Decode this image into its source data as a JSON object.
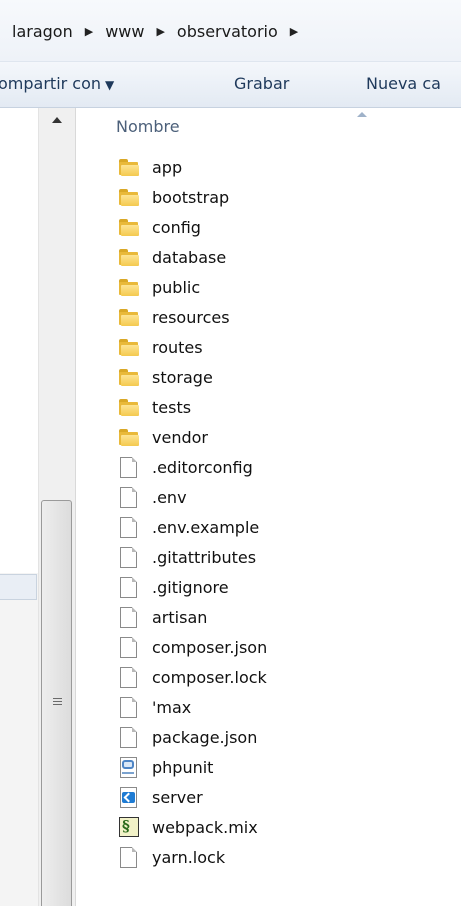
{
  "breadcrumb": {
    "items": [
      "laragon",
      "www",
      "observatorio"
    ],
    "separator": "▶"
  },
  "toolbar": {
    "share_label": "ompartir con",
    "record_label": "Grabar",
    "new_folder_label": "Nueva ca"
  },
  "column_header": {
    "name_label": "Nombre"
  },
  "files": [
    {
      "name": "app",
      "icon": "folder-icon"
    },
    {
      "name": "bootstrap",
      "icon": "folder-icon"
    },
    {
      "name": "config",
      "icon": "folder-icon"
    },
    {
      "name": "database",
      "icon": "folder-icon"
    },
    {
      "name": "public",
      "icon": "folder-icon"
    },
    {
      "name": "resources",
      "icon": "folder-icon"
    },
    {
      "name": "routes",
      "icon": "folder-icon"
    },
    {
      "name": "storage",
      "icon": "folder-icon"
    },
    {
      "name": "tests",
      "icon": "folder-icon"
    },
    {
      "name": "vendor",
      "icon": "folder-icon"
    },
    {
      "name": ".editorconfig",
      "icon": "file-icon"
    },
    {
      "name": ".env",
      "icon": "file-icon"
    },
    {
      "name": ".env.example",
      "icon": "file-icon"
    },
    {
      "name": ".gitattributes",
      "icon": "file-icon"
    },
    {
      "name": ".gitignore",
      "icon": "file-icon"
    },
    {
      "name": "artisan",
      "icon": "file-icon"
    },
    {
      "name": "composer.json",
      "icon": "file-icon"
    },
    {
      "name": "composer.lock",
      "icon": "file-icon"
    },
    {
      "name": "'max",
      "icon": "file-icon"
    },
    {
      "name": "package.json",
      "icon": "file-icon"
    },
    {
      "name": "phpunit",
      "icon": "xml-config-file-icon"
    },
    {
      "name": "server",
      "icon": "vscode-file-icon"
    },
    {
      "name": "webpack.mix",
      "icon": "script-file-icon"
    },
    {
      "name": "yarn.lock",
      "icon": "file-icon"
    }
  ],
  "colors": {
    "toolbar_text": "#1e395b",
    "folder": "#f4c94f",
    "header_text": "#4c607a"
  }
}
